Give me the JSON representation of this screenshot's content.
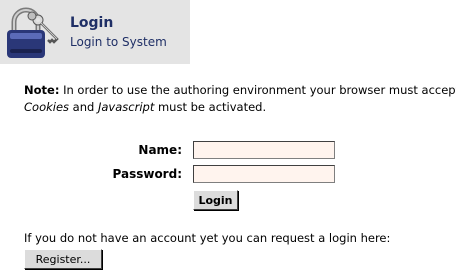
{
  "header": {
    "title": "Login",
    "subtitle": "Login to System",
    "icon": "lock-with-keys-icon"
  },
  "note": {
    "label": "Note:",
    "text_1": " In order to use the authoring environment your browser must accept",
    "cookies": "Cookies",
    "and": " and ",
    "javascript": "Javascript",
    "text_2": " must be activated."
  },
  "form": {
    "name_label": "Name:",
    "name_value": "",
    "password_label": "Password:",
    "password_value": "",
    "login_button": "Login"
  },
  "register": {
    "info": "If you do not have an account yet you can request a login here:",
    "button": "Register..."
  },
  "colors": {
    "header_bg": "#e4e4e4",
    "title": "#1f2f66",
    "field_bg": "#fff4ee"
  }
}
